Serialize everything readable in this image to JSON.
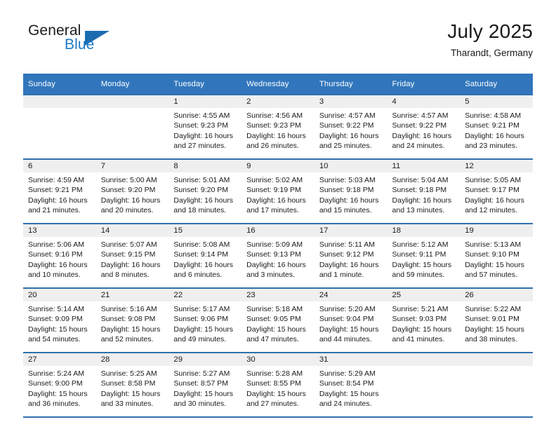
{
  "brand": {
    "name_top": "General",
    "name_bottom": "Blue",
    "accent_color": "#1b6cb0",
    "blue_text_color": "#1c78c8"
  },
  "header": {
    "title": "July 2025",
    "subtitle": "Tharandt, Germany"
  },
  "calendar": {
    "header_bg": "#3176bc",
    "row_rule_color": "#2f6fae",
    "daynum_band_bg": "#efefef",
    "weekdays": [
      "Sunday",
      "Monday",
      "Tuesday",
      "Wednesday",
      "Thursday",
      "Friday",
      "Saturday"
    ],
    "weeks": [
      [
        {
          "day": "",
          "sunrise": "",
          "sunset": "",
          "daylight_l1": "",
          "daylight_l2": ""
        },
        {
          "day": "",
          "sunrise": "",
          "sunset": "",
          "daylight_l1": "",
          "daylight_l2": ""
        },
        {
          "day": "1",
          "sunrise": "Sunrise: 4:55 AM",
          "sunset": "Sunset: 9:23 PM",
          "daylight_l1": "Daylight: 16 hours",
          "daylight_l2": "and 27 minutes."
        },
        {
          "day": "2",
          "sunrise": "Sunrise: 4:56 AM",
          "sunset": "Sunset: 9:23 PM",
          "daylight_l1": "Daylight: 16 hours",
          "daylight_l2": "and 26 minutes."
        },
        {
          "day": "3",
          "sunrise": "Sunrise: 4:57 AM",
          "sunset": "Sunset: 9:22 PM",
          "daylight_l1": "Daylight: 16 hours",
          "daylight_l2": "and 25 minutes."
        },
        {
          "day": "4",
          "sunrise": "Sunrise: 4:57 AM",
          "sunset": "Sunset: 9:22 PM",
          "daylight_l1": "Daylight: 16 hours",
          "daylight_l2": "and 24 minutes."
        },
        {
          "day": "5",
          "sunrise": "Sunrise: 4:58 AM",
          "sunset": "Sunset: 9:21 PM",
          "daylight_l1": "Daylight: 16 hours",
          "daylight_l2": "and 23 minutes."
        }
      ],
      [
        {
          "day": "6",
          "sunrise": "Sunrise: 4:59 AM",
          "sunset": "Sunset: 9:21 PM",
          "daylight_l1": "Daylight: 16 hours",
          "daylight_l2": "and 21 minutes."
        },
        {
          "day": "7",
          "sunrise": "Sunrise: 5:00 AM",
          "sunset": "Sunset: 9:20 PM",
          "daylight_l1": "Daylight: 16 hours",
          "daylight_l2": "and 20 minutes."
        },
        {
          "day": "8",
          "sunrise": "Sunrise: 5:01 AM",
          "sunset": "Sunset: 9:20 PM",
          "daylight_l1": "Daylight: 16 hours",
          "daylight_l2": "and 18 minutes."
        },
        {
          "day": "9",
          "sunrise": "Sunrise: 5:02 AM",
          "sunset": "Sunset: 9:19 PM",
          "daylight_l1": "Daylight: 16 hours",
          "daylight_l2": "and 17 minutes."
        },
        {
          "day": "10",
          "sunrise": "Sunrise: 5:03 AM",
          "sunset": "Sunset: 9:18 PM",
          "daylight_l1": "Daylight: 16 hours",
          "daylight_l2": "and 15 minutes."
        },
        {
          "day": "11",
          "sunrise": "Sunrise: 5:04 AM",
          "sunset": "Sunset: 9:18 PM",
          "daylight_l1": "Daylight: 16 hours",
          "daylight_l2": "and 13 minutes."
        },
        {
          "day": "12",
          "sunrise": "Sunrise: 5:05 AM",
          "sunset": "Sunset: 9:17 PM",
          "daylight_l1": "Daylight: 16 hours",
          "daylight_l2": "and 12 minutes."
        }
      ],
      [
        {
          "day": "13",
          "sunrise": "Sunrise: 5:06 AM",
          "sunset": "Sunset: 9:16 PM",
          "daylight_l1": "Daylight: 16 hours",
          "daylight_l2": "and 10 minutes."
        },
        {
          "day": "14",
          "sunrise": "Sunrise: 5:07 AM",
          "sunset": "Sunset: 9:15 PM",
          "daylight_l1": "Daylight: 16 hours",
          "daylight_l2": "and 8 minutes."
        },
        {
          "day": "15",
          "sunrise": "Sunrise: 5:08 AM",
          "sunset": "Sunset: 9:14 PM",
          "daylight_l1": "Daylight: 16 hours",
          "daylight_l2": "and 6 minutes."
        },
        {
          "day": "16",
          "sunrise": "Sunrise: 5:09 AM",
          "sunset": "Sunset: 9:13 PM",
          "daylight_l1": "Daylight: 16 hours",
          "daylight_l2": "and 3 minutes."
        },
        {
          "day": "17",
          "sunrise": "Sunrise: 5:11 AM",
          "sunset": "Sunset: 9:12 PM",
          "daylight_l1": "Daylight: 16 hours",
          "daylight_l2": "and 1 minute."
        },
        {
          "day": "18",
          "sunrise": "Sunrise: 5:12 AM",
          "sunset": "Sunset: 9:11 PM",
          "daylight_l1": "Daylight: 15 hours",
          "daylight_l2": "and 59 minutes."
        },
        {
          "day": "19",
          "sunrise": "Sunrise: 5:13 AM",
          "sunset": "Sunset: 9:10 PM",
          "daylight_l1": "Daylight: 15 hours",
          "daylight_l2": "and 57 minutes."
        }
      ],
      [
        {
          "day": "20",
          "sunrise": "Sunrise: 5:14 AM",
          "sunset": "Sunset: 9:09 PM",
          "daylight_l1": "Daylight: 15 hours",
          "daylight_l2": "and 54 minutes."
        },
        {
          "day": "21",
          "sunrise": "Sunrise: 5:16 AM",
          "sunset": "Sunset: 9:08 PM",
          "daylight_l1": "Daylight: 15 hours",
          "daylight_l2": "and 52 minutes."
        },
        {
          "day": "22",
          "sunrise": "Sunrise: 5:17 AM",
          "sunset": "Sunset: 9:06 PM",
          "daylight_l1": "Daylight: 15 hours",
          "daylight_l2": "and 49 minutes."
        },
        {
          "day": "23",
          "sunrise": "Sunrise: 5:18 AM",
          "sunset": "Sunset: 9:05 PM",
          "daylight_l1": "Daylight: 15 hours",
          "daylight_l2": "and 47 minutes."
        },
        {
          "day": "24",
          "sunrise": "Sunrise: 5:20 AM",
          "sunset": "Sunset: 9:04 PM",
          "daylight_l1": "Daylight: 15 hours",
          "daylight_l2": "and 44 minutes."
        },
        {
          "day": "25",
          "sunrise": "Sunrise: 5:21 AM",
          "sunset": "Sunset: 9:03 PM",
          "daylight_l1": "Daylight: 15 hours",
          "daylight_l2": "and 41 minutes."
        },
        {
          "day": "26",
          "sunrise": "Sunrise: 5:22 AM",
          "sunset": "Sunset: 9:01 PM",
          "daylight_l1": "Daylight: 15 hours",
          "daylight_l2": "and 38 minutes."
        }
      ],
      [
        {
          "day": "27",
          "sunrise": "Sunrise: 5:24 AM",
          "sunset": "Sunset: 9:00 PM",
          "daylight_l1": "Daylight: 15 hours",
          "daylight_l2": "and 36 minutes."
        },
        {
          "day": "28",
          "sunrise": "Sunrise: 5:25 AM",
          "sunset": "Sunset: 8:58 PM",
          "daylight_l1": "Daylight: 15 hours",
          "daylight_l2": "and 33 minutes."
        },
        {
          "day": "29",
          "sunrise": "Sunrise: 5:27 AM",
          "sunset": "Sunset: 8:57 PM",
          "daylight_l1": "Daylight: 15 hours",
          "daylight_l2": "and 30 minutes."
        },
        {
          "day": "30",
          "sunrise": "Sunrise: 5:28 AM",
          "sunset": "Sunset: 8:55 PM",
          "daylight_l1": "Daylight: 15 hours",
          "daylight_l2": "and 27 minutes."
        },
        {
          "day": "31",
          "sunrise": "Sunrise: 5:29 AM",
          "sunset": "Sunset: 8:54 PM",
          "daylight_l1": "Daylight: 15 hours",
          "daylight_l2": "and 24 minutes."
        },
        {
          "day": "",
          "sunrise": "",
          "sunset": "",
          "daylight_l1": "",
          "daylight_l2": ""
        },
        {
          "day": "",
          "sunrise": "",
          "sunset": "",
          "daylight_l1": "",
          "daylight_l2": ""
        }
      ]
    ]
  }
}
